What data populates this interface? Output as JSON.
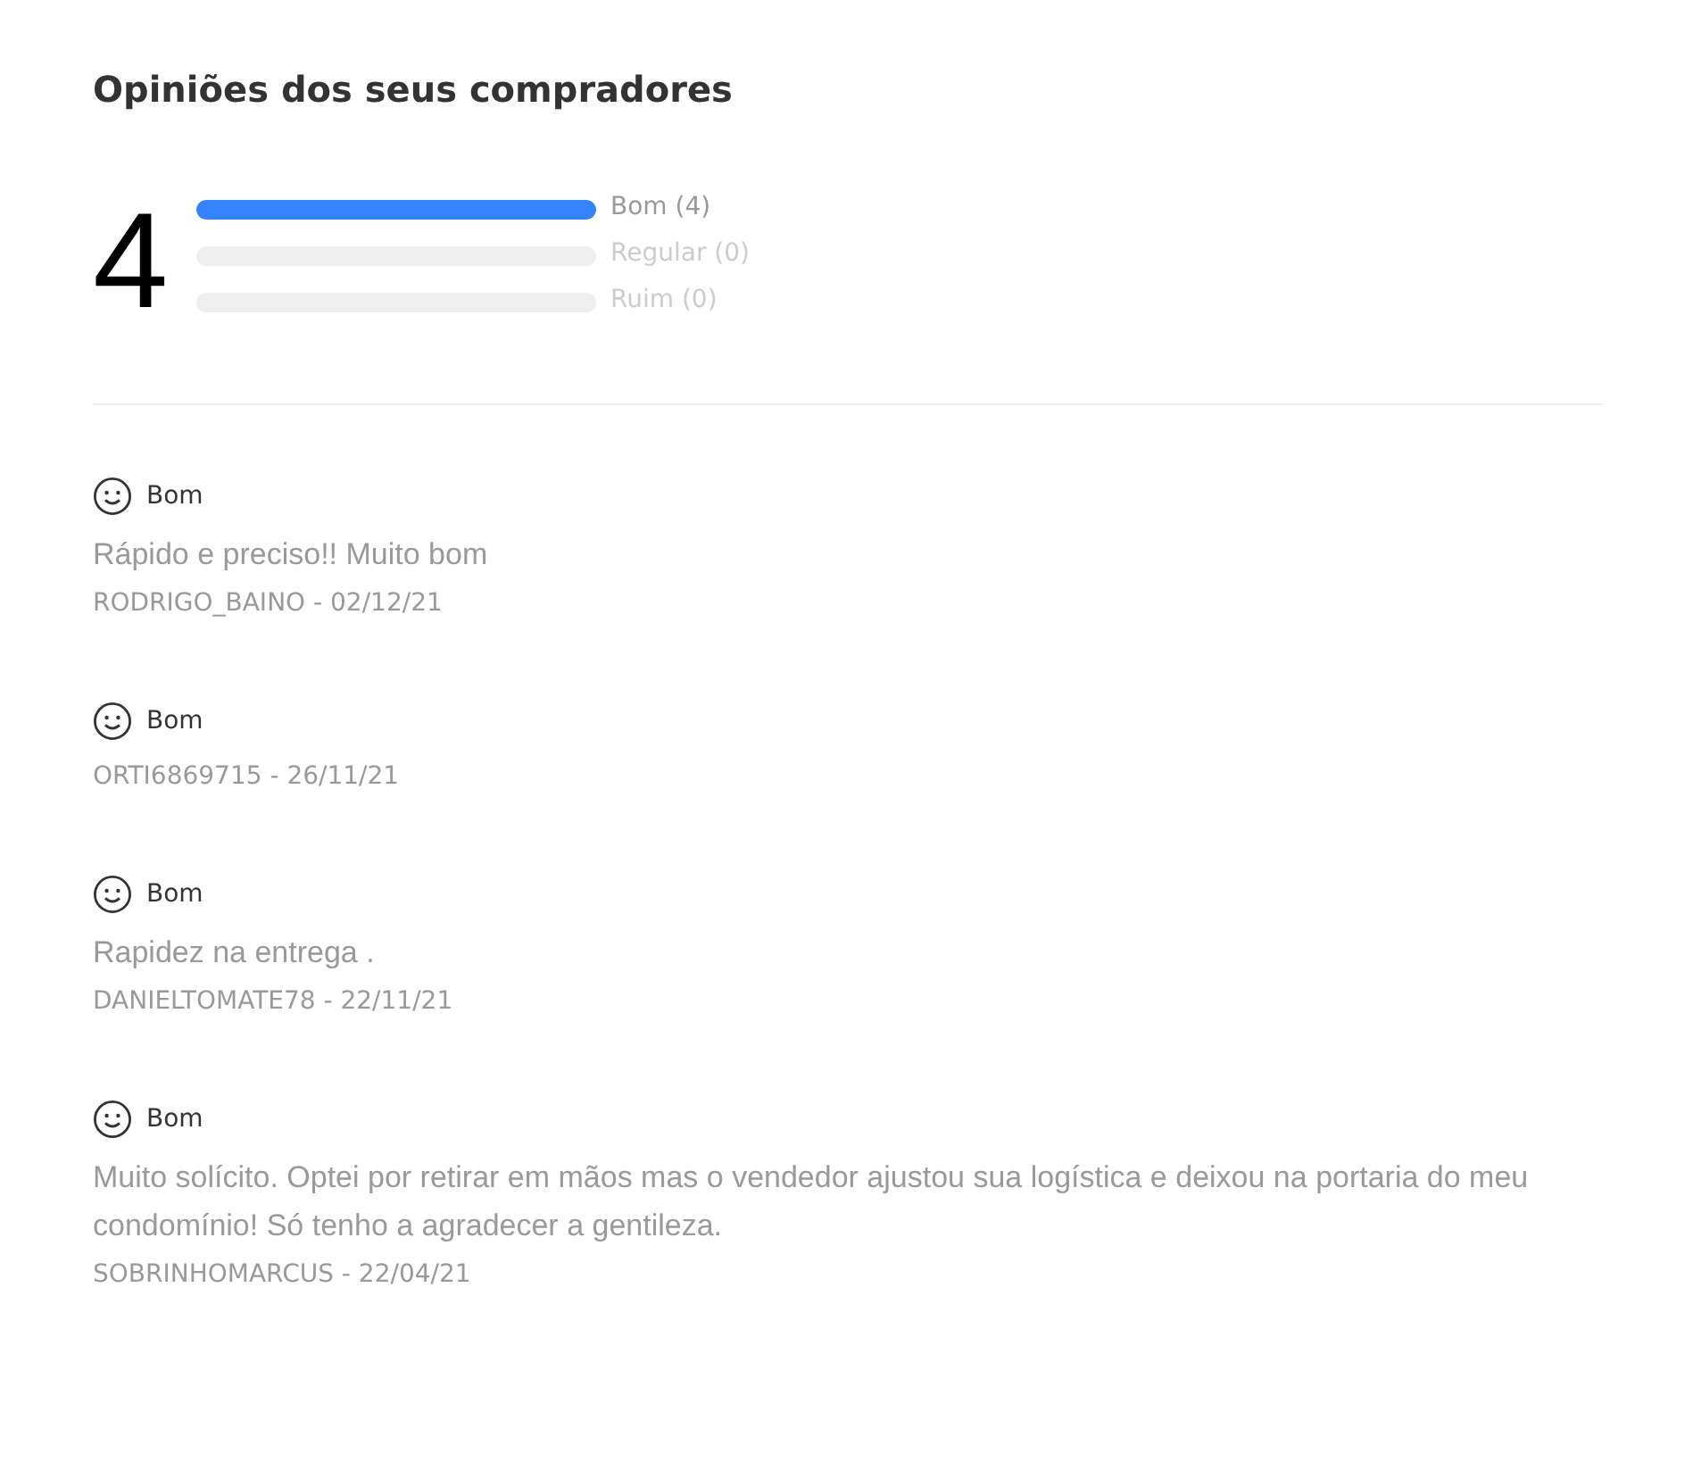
{
  "title": "Opiniões dos seus compradores",
  "summary": {
    "score": "4",
    "bars": [
      {
        "label": "Bom (4)",
        "level": 1
      },
      {
        "label": "Regular (0)",
        "level": 0
      },
      {
        "label": "Ruim (0)",
        "level": 0
      }
    ]
  },
  "reviews": [
    {
      "rating": "Bom",
      "comment": "Rápido e preciso!! Muito bom",
      "author": "RODRIGO_BAINO - 02/12/21"
    },
    {
      "rating": "Bom",
      "author": "ORTI6869715 - 26/11/21"
    },
    {
      "rating": "Bom",
      "comment": "Rapidez na entrega .",
      "author": "DANIELTOMATE78 - 22/11/21"
    },
    {
      "rating": "Bom",
      "comment": "Muito solícito. Optei por retirar em mãos mas o vendedor ajustou sua logística e deixou na portaria do meu condomínio! Só tenho a agradecer a gentileza.",
      "author": "SOBRINHOMARCUS - 22/04/21"
    }
  ]
}
